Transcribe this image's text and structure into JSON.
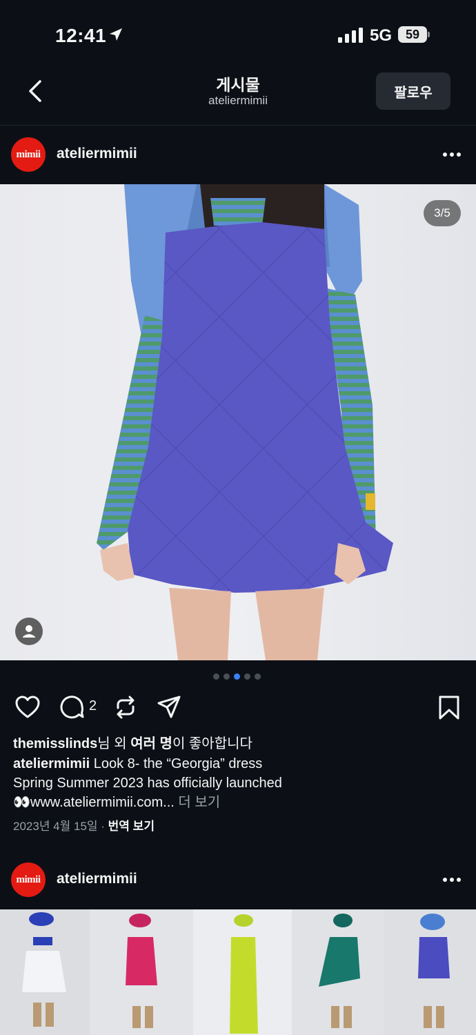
{
  "status": {
    "time": "12:41",
    "network": "5G",
    "battery": "59"
  },
  "header": {
    "title": "게시물",
    "subtitle": "ateliermimii",
    "follow_label": "팔로우"
  },
  "post": {
    "avatar_text": "mimii",
    "username": "ateliermimii",
    "counter": "3/5",
    "comment_count": "2",
    "likes_user": "themisslinds",
    "likes_mid": "님 외 ",
    "likes_bold": "여러 명",
    "likes_tail": "이 좋아합니다",
    "caption_user": "ateliermimii",
    "caption_line1": " Look 8- the “Georgia” dress",
    "caption_line2": "Spring Summer 2023 has officially launched",
    "caption_line3": "👀www.ateliermimii.com...",
    "more_label": " 더 보기",
    "date": "2023년 4월 15일",
    "separator": " · ",
    "translate_label": "번역 보기"
  },
  "next_post": {
    "avatar_text": "mimii",
    "username": "ateliermimii"
  },
  "carousel": {
    "total": 5,
    "active": 3
  },
  "colors": {
    "background": "#0c1016",
    "accent": "#3b82f6",
    "avatar_red": "#e31b13",
    "dress": "#5a58c4"
  }
}
